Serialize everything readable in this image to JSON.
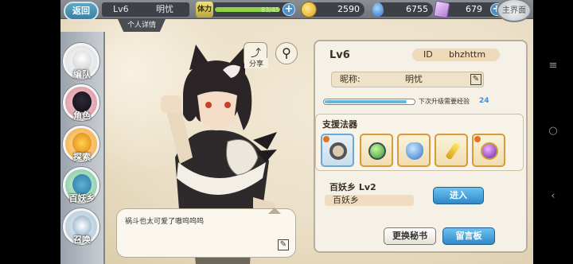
{
  "top_bar": {
    "back_label": "返回",
    "level_label": "Lv6",
    "player_name": "明忧",
    "stamina_label": "体力",
    "stamina_value": "83/45",
    "stamina_fill_pct": 100,
    "gold": "2590",
    "water": "6755",
    "gems": "679",
    "home_label": "主界面"
  },
  "sub_tab": "个人详情",
  "left_nav": [
    {
      "label": "编队"
    },
    {
      "label": "角色"
    },
    {
      "label": "探索"
    },
    {
      "label": "百妖乡"
    },
    {
      "label": "召唤"
    }
  ],
  "actions": {
    "share_label": "分享"
  },
  "speech": {
    "text": "祸斗也太可爱了嗷呜呜呜"
  },
  "profile": {
    "level": "Lv6",
    "id_label": "ID",
    "id_value": "bhzhttm",
    "nickname_label": "昵称:",
    "nickname": "明忧",
    "exp_text": "下次升级需要经验",
    "exp_needed": "24",
    "exp_fill_pct": 90
  },
  "treasures": {
    "title": "支援法器",
    "items": [
      {
        "icon": "scroll-dial-icon",
        "selected": true
      },
      {
        "icon": "green-orb-icon",
        "selected": false
      },
      {
        "icon": "blue-gourd-icon",
        "selected": false
      },
      {
        "icon": "golden-scepter-icon",
        "selected": false
      },
      {
        "icon": "purple-orb-icon",
        "selected": false
      }
    ]
  },
  "village": {
    "title": "百妖乡  Lv2",
    "name": "百妖乡",
    "enter_label": "进入"
  },
  "buttons": {
    "change_secretary": "更换秘书",
    "message_board": "留言板"
  }
}
